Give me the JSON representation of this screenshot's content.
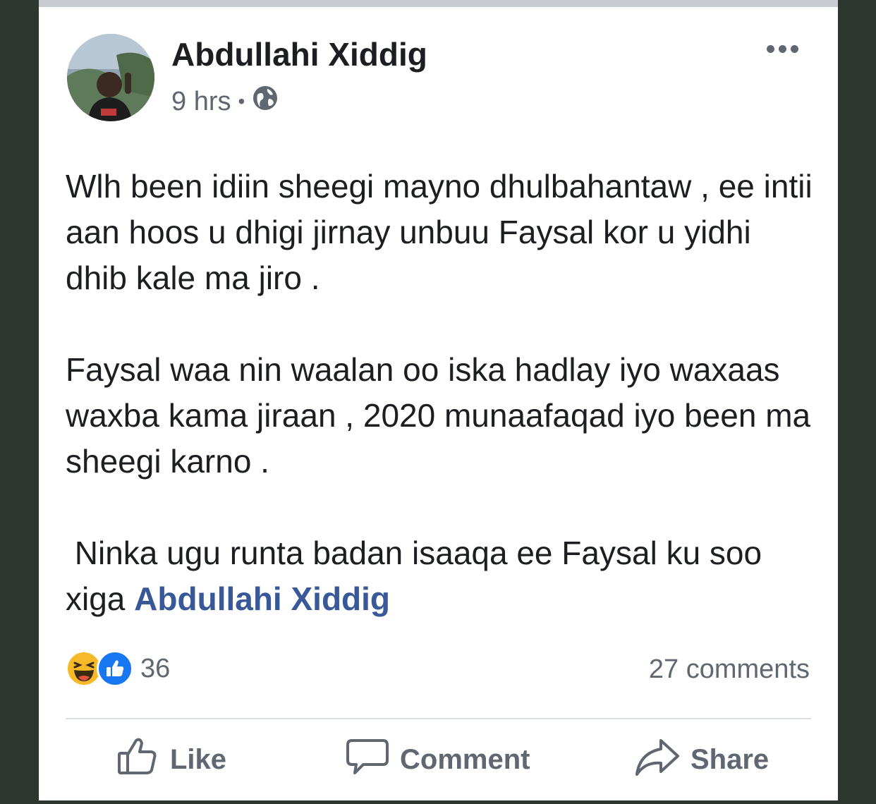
{
  "post": {
    "author": "Abdullahi Xiddig",
    "time": "9 hrs",
    "separator": "•",
    "privacy_icon": "globe-icon",
    "more_icon": "more-options-icon",
    "paragraphs": [
      "Wlh been idiin sheegi mayno dhulbahantaw , ee intii aan hoos u dhigi jirnay unbuu Faysal kor u yidhi dhib kale ma jiro .",
      "Faysal waa nin waalan oo iska hadlay iyo waxaas waxba kama jiraan , 2020 munaafaqad iyo been ma sheegi karno ."
    ],
    "last_paragraph_prefix": " Ninka ugu runta badan isaaqa ee Faysal ku soo xiga ",
    "mention": "Abdullahi Xiddig"
  },
  "reactions": {
    "icons": [
      "haha-icon",
      "like-icon"
    ],
    "count": "36",
    "comments": "27 comments"
  },
  "actions": {
    "like": "Like",
    "comment": "Comment",
    "share": "Share"
  },
  "colors": {
    "mention": "#385898",
    "like_blue": "#1877f2",
    "haha_yellow": "#f7b928",
    "muted": "#606770",
    "text": "#1c1e21"
  }
}
